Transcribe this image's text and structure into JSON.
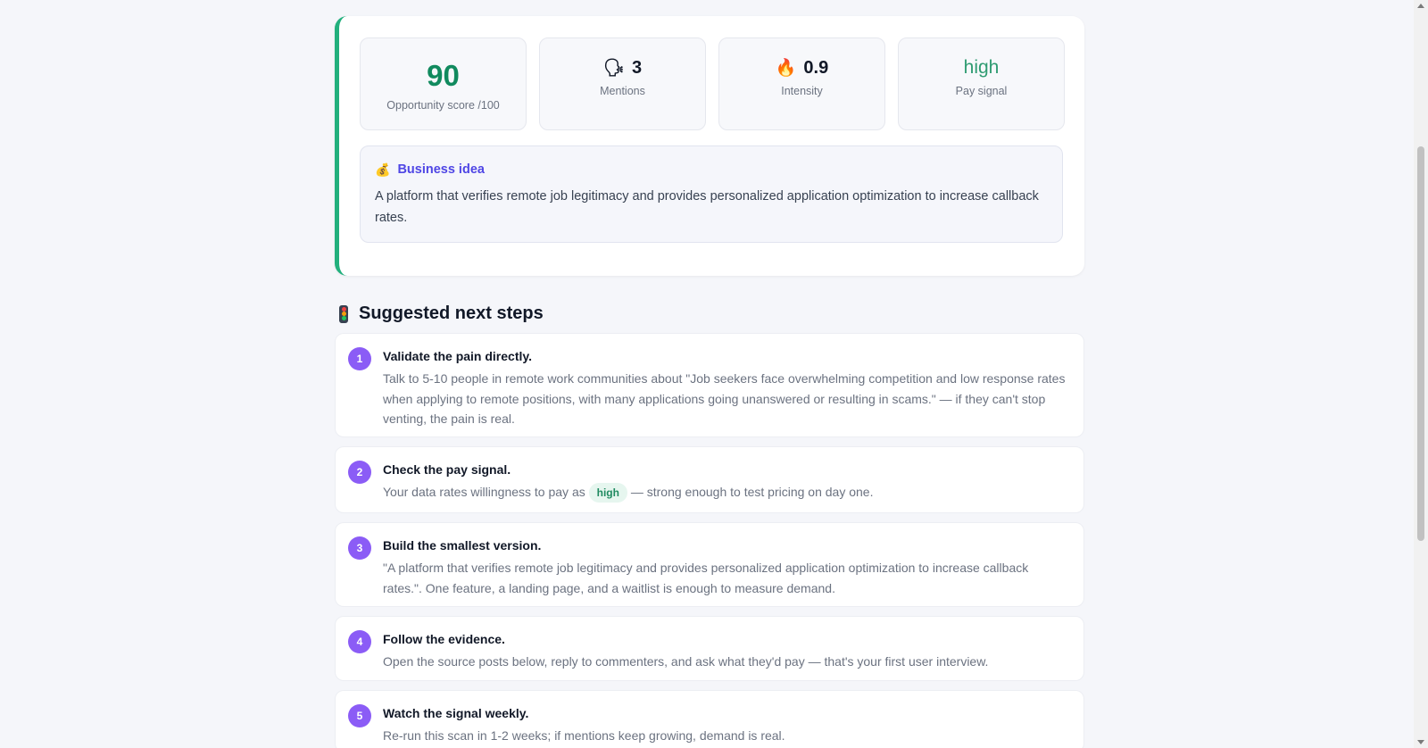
{
  "metrics": {
    "score": {
      "value": "90",
      "label": "Opportunity score /100"
    },
    "mentions": {
      "icon": "speaking-head-icon",
      "value": "3",
      "label": "Mentions"
    },
    "intensity": {
      "icon": "fire-icon",
      "value": "0.9",
      "label": "Intensity"
    },
    "pay": {
      "value": "high",
      "label": "Pay signal"
    }
  },
  "idea": {
    "icon": "money-bag-icon",
    "title": "Business idea",
    "text": "A platform that verifies remote job legitimacy and provides personalized application optimization to increase callback rates."
  },
  "steps_heading": {
    "icon": "traffic-light-icon",
    "title": "Suggested next steps"
  },
  "steps": [
    {
      "num": "1",
      "title": "Validate the pain directly.",
      "body": "Talk to 5-10 people in remote work communities about \"Job seekers face overwhelming competition and low response rates when applying to remote positions, with many applications going unanswered or resulting in scams.\" — if they can't stop venting, the pain is real."
    },
    {
      "num": "2",
      "title": "Check the pay signal.",
      "body_before": "Your data rates willingness to pay as",
      "pill": "high",
      "body_after": "— strong enough to test pricing on day one."
    },
    {
      "num": "3",
      "title": "Build the smallest version.",
      "body": "\"A platform that verifies remote job legitimacy and provides personalized application optimization to increase callback rates.\". One feature, a landing page, and a waitlist is enough to measure demand."
    },
    {
      "num": "4",
      "title": "Follow the evidence.",
      "body": "Open the source posts below, reply to commenters, and ask what they'd pay — that's your first user interview."
    },
    {
      "num": "5",
      "title": "Watch the signal weekly.",
      "body": "Re-run this scan in 1-2 weeks; if mentions keep growing, demand is real."
    }
  ],
  "colors": {
    "accent_green": "#22b07d",
    "score_green": "#118a5e",
    "step_purple": "#8b5cf6",
    "idea_indigo": "#4f46e5"
  }
}
